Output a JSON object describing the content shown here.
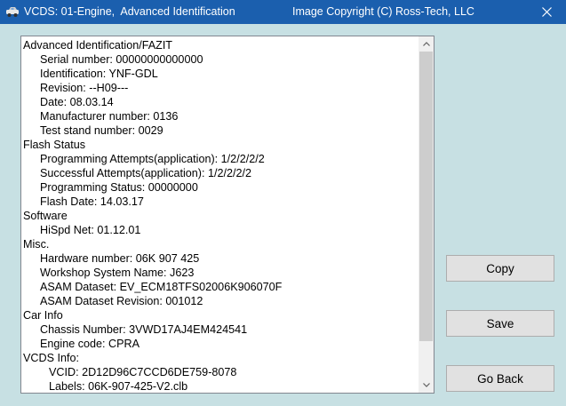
{
  "window": {
    "title": "VCDS: 01-Engine,  Advanced Identification",
    "copyright": "Image Copyright (C) Ross-Tech, LLC"
  },
  "icons": {
    "app": "vcds-car-icon",
    "close": "close-icon",
    "scroll_up": "scroll-up-arrow-icon",
    "scroll_down": "scroll-down-arrow-icon"
  },
  "info": {
    "lines": [
      {
        "text": "Advanced Identification/FAZIT",
        "level": 0
      },
      {
        "text": "Serial number: 00000000000000",
        "level": 1
      },
      {
        "text": "Identification: YNF-GDL",
        "level": 1
      },
      {
        "text": "Revision: --H09---",
        "level": 1
      },
      {
        "text": "Date: 08.03.14",
        "level": 1
      },
      {
        "text": "Manufacturer number: 0136",
        "level": 1
      },
      {
        "text": "Test stand number: 0029",
        "level": 1
      },
      {
        "text": "Flash Status",
        "level": 0
      },
      {
        "text": "Programming Attempts(application): 1/2/2/2/2",
        "level": 1
      },
      {
        "text": "Successful Attempts(application): 1/2/2/2/2",
        "level": 1
      },
      {
        "text": "Programming Status: 00000000",
        "level": 1
      },
      {
        "text": "Flash Date: 14.03.17",
        "level": 1
      },
      {
        "text": "Software",
        "level": 0
      },
      {
        "text": "HiSpd Net: 01.12.01",
        "level": 1
      },
      {
        "text": "Misc.",
        "level": 0
      },
      {
        "text": "Hardware number: 06K 907 425",
        "level": 1
      },
      {
        "text": "Workshop System Name: J623",
        "level": 1
      },
      {
        "text": "ASAM Dataset: EV_ECM18TFS02006K906070F",
        "level": 1
      },
      {
        "text": "ASAM Dataset Revision: 001012",
        "level": 1
      },
      {
        "text": "Car Info",
        "level": 0
      },
      {
        "text": "Chassis Number: 3VWD17AJ4EM424541",
        "level": 1
      },
      {
        "text": "Engine code: CPRA",
        "level": 1
      },
      {
        "text": "VCDS Info:",
        "level": 0
      },
      {
        "text": "VCID: 2D12D96C7CCD6DE759-8078",
        "level": 2
      },
      {
        "text": "Labels: 06K-907-425-V2.clb",
        "level": 2
      }
    ]
  },
  "buttons": {
    "copy": "Copy",
    "save": "Save",
    "go_back": "Go Back"
  },
  "colors": {
    "titlebar": "#1b5fae",
    "background": "#c7e0e3",
    "button": "#e1e1e1"
  }
}
